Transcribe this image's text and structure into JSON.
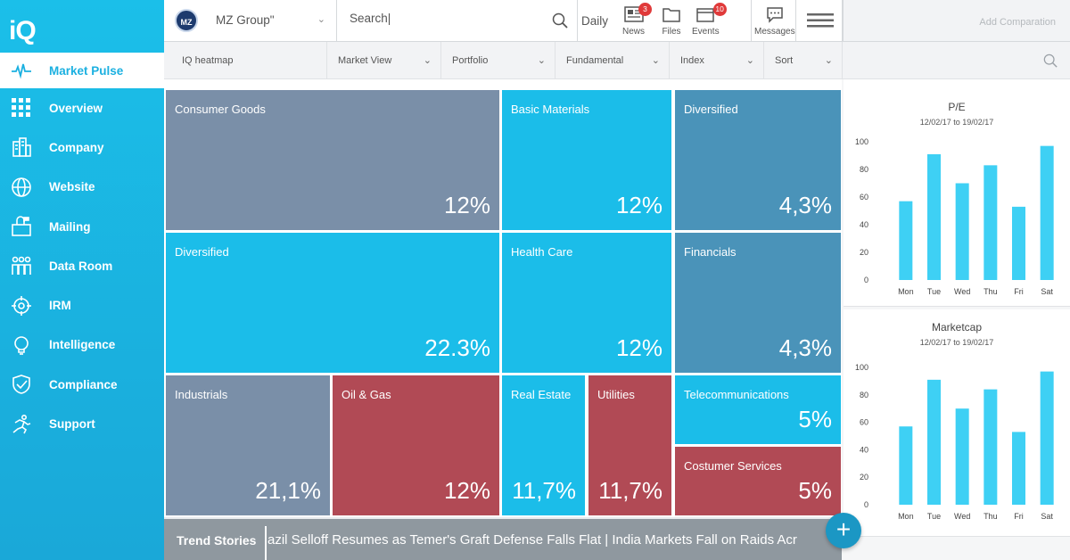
{
  "app": {
    "logo": "iQ"
  },
  "sidebar": {
    "items": [
      {
        "label": "Market Pulse",
        "icon": "pulse-icon",
        "active": true
      },
      {
        "label": "Overview",
        "icon": "grid-icon"
      },
      {
        "label": "Company",
        "icon": "building-icon"
      },
      {
        "label": "Website",
        "icon": "globe-icon"
      },
      {
        "label": "Mailing",
        "icon": "mailbox-icon"
      },
      {
        "label": "Data Room",
        "icon": "people-icon"
      },
      {
        "label": "IRM",
        "icon": "target-icon"
      },
      {
        "label": "Intelligence",
        "icon": "lightbulb-icon"
      },
      {
        "label": "Compliance",
        "icon": "shield-check-icon"
      },
      {
        "label": "Support",
        "icon": "runner-icon"
      }
    ]
  },
  "topbar": {
    "company_logo": "MZ",
    "company_name": "MZ Group\"",
    "search_value": "Search|",
    "daily": "Daily",
    "icons": [
      {
        "label": "News",
        "icon": "newspaper-icon",
        "badge": "3"
      },
      {
        "label": "Files",
        "icon": "folder-icon",
        "badge": ""
      },
      {
        "label": "Events",
        "icon": "calendar-icon",
        "badge": "10"
      }
    ],
    "messages": "Messages",
    "add_comparison": "Add Comparation"
  },
  "filters": [
    {
      "label": "IQ heatmap",
      "dropdown": false
    },
    {
      "label": "Market View",
      "dropdown": true
    },
    {
      "label": "Portfolio",
      "dropdown": true
    },
    {
      "label": "Fundamental",
      "dropdown": true
    },
    {
      "label": "Index",
      "dropdown": true
    },
    {
      "label": "Sort",
      "dropdown": true
    }
  ],
  "colors": {
    "blue": "#1bbde9",
    "slate": "#7a8fa8",
    "steel": "#4a93b9",
    "red": "#b14a55",
    "accent": "#1bb0e0"
  },
  "heatmap": [
    {
      "name": "Consumer Goods",
      "value": "12%",
      "color": "slate"
    },
    {
      "name": "Basic Materials",
      "value": "12%",
      "color": "blue"
    },
    {
      "name": "Diversified",
      "value": "4,3%",
      "color": "steel"
    },
    {
      "name": "Diversified",
      "value": "22.3%",
      "color": "blue"
    },
    {
      "name": "Health Care",
      "value": "12%",
      "color": "blue"
    },
    {
      "name": "Financials",
      "value": "4,3%",
      "color": "steel"
    },
    {
      "name": "Industrials",
      "value": "21,1%",
      "color": "slate"
    },
    {
      "name": "Oil & Gas",
      "value": "12%",
      "color": "red"
    },
    {
      "name": "Real Estate",
      "value": "11,7%",
      "color": "blue"
    },
    {
      "name": "Utilities",
      "value": "11,7%",
      "color": "red"
    },
    {
      "name": "Telecommunications",
      "value": "5%",
      "color": "blue"
    },
    {
      "name": "Costumer Services",
      "value": "5%",
      "color": "red"
    }
  ],
  "trend": {
    "label": "Trend Stories",
    "text": "azil Selloff Resumes as Temer's Graft Defense Falls Flat   |   India Markets Fall on Raids Acr"
  },
  "fab_label": "+",
  "chart_data": [
    {
      "type": "bar",
      "title": "P/E",
      "subtitle": "12/02/17 to 19/02/17",
      "categories": [
        "Mon",
        "Tue",
        "Wed",
        "Thu",
        "Fri",
        "Sat"
      ],
      "values": [
        57,
        91,
        70,
        83,
        53,
        97
      ],
      "ylim": [
        0,
        100
      ],
      "yticks": [
        0,
        20,
        40,
        60,
        80,
        100
      ],
      "color": "#3ed0f4"
    },
    {
      "type": "bar",
      "title": "Marketcap",
      "subtitle": "12/02/17 to 19/02/17",
      "categories": [
        "Mon",
        "Tue",
        "Wed",
        "Thu",
        "Fri",
        "Sat"
      ],
      "values": [
        57,
        91,
        70,
        84,
        53,
        97
      ],
      "ylim": [
        0,
        100
      ],
      "yticks": [
        0,
        20,
        40,
        60,
        80,
        100
      ],
      "color": "#3ed0f4"
    }
  ]
}
